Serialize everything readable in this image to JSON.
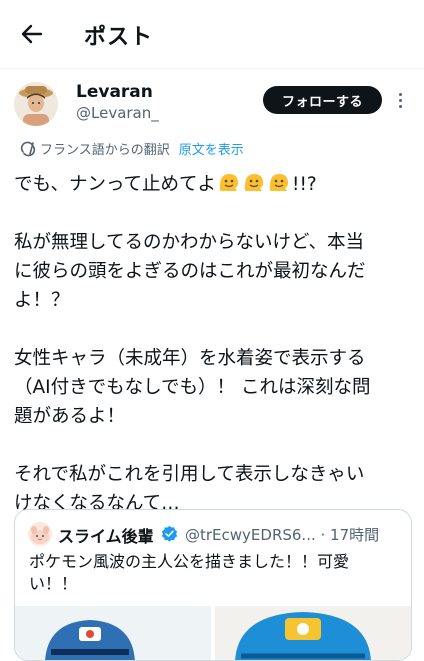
{
  "header": {
    "title": "ポスト"
  },
  "author": {
    "display_name": "Levaran",
    "handle": "@Levaran_"
  },
  "follow_button": {
    "label": "フォローする"
  },
  "translation": {
    "note": "フランス語からの翻訳",
    "show_original": "原文を表示"
  },
  "post": {
    "line1_prefix": "でも、ナンって止めてよ",
    "line1_suffix": "!!?",
    "emoji": [
      "🫠",
      "🫠",
      "🫠"
    ],
    "lines_p2": [
      "私が無理してるのかわからないけど、本当",
      "に彼らの頭をよぎるのはこれが最初なんだ",
      "よ！？"
    ],
    "lines_p3": [
      "女性キャラ（未成年）を水着姿で表示する",
      "（AI付きでもなしでも）！ これは深刻な問",
      "題があるよ！"
    ],
    "lines_p4": [
      "それで私がこれを引用して表示しなきゃい",
      "けなくなるなんて…"
    ]
  },
  "quote": {
    "display_name": "スライム後輩",
    "handle_time": "@trEcwyEDRS6... · 17時間",
    "lines": [
      "ポケモン風波の主人公を描きました！！可愛",
      "い！！"
    ]
  },
  "colors": {
    "link": "#1d9bf0",
    "text": "#0f1419",
    "secondary": "#536471",
    "border": "#cfd9de"
  },
  "icons": [
    "back-arrow-icon",
    "more-vertical-icon",
    "translate-icon",
    "verified-badge-icon"
  ]
}
